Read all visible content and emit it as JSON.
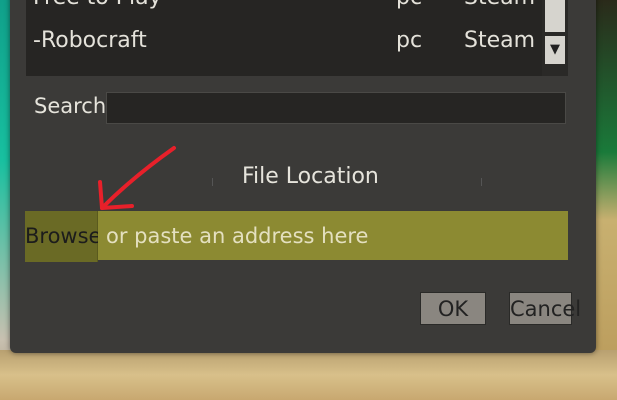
{
  "games": {
    "rows": [
      {
        "name": "Free to Play",
        "platform": "pc",
        "store": "Steam"
      },
      {
        "name": "-Robocraft",
        "platform": "pc",
        "store": "Steam"
      }
    ],
    "scroll_down_icon": "▼"
  },
  "search": {
    "label": "Search:",
    "value": ""
  },
  "file_location": {
    "title": "File Location",
    "browse_label": "Browse",
    "address_placeholder": "or paste an address here"
  },
  "buttons": {
    "ok_label": "OK",
    "cancel_label": "Cancel"
  },
  "annotation": {
    "icon": "red-arrow-icon",
    "color": "#e8202a"
  },
  "colors": {
    "dialog_bg": "#3b3a38",
    "list_bg": "#262523",
    "browse_bg": "#6a6a25",
    "address_bg": "#8c8a32"
  }
}
